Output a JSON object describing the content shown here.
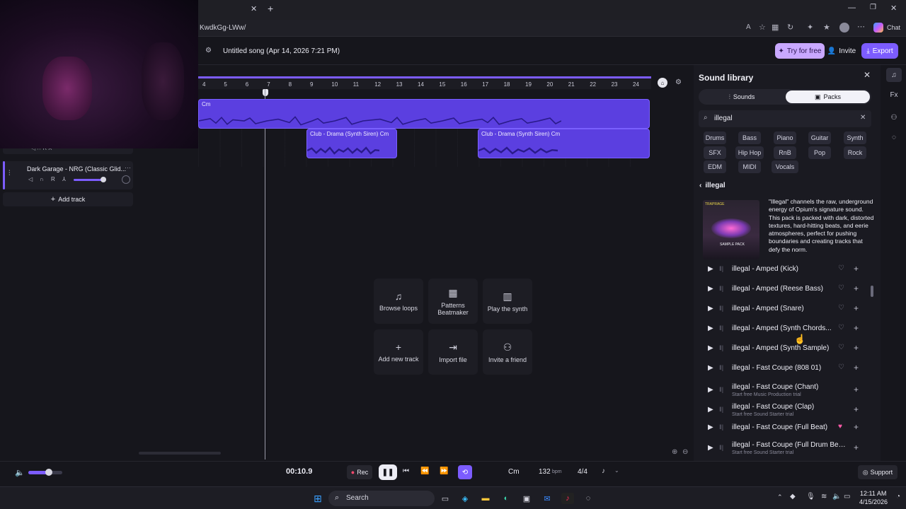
{
  "browser": {
    "address_text": "KwdkGg-LWw/",
    "chat_label": "Chat"
  },
  "header": {
    "song_title": "Untitled song (Apr 14, 2026 7:21 PM)",
    "try_free_label": "Try for free",
    "invite_label": "Invite",
    "export_label": "Export"
  },
  "timeline": {
    "ruler_ticks": [
      "4",
      "5",
      "6",
      "7",
      "8",
      "9",
      "10",
      "11",
      "12",
      "13",
      "14",
      "15",
      "16",
      "17",
      "18",
      "19",
      "20",
      "21",
      "22",
      "23",
      "24"
    ],
    "top_clip_label": "Cm",
    "clips": [
      {
        "label": "Club - Drama (Synth Siren) Cm"
      },
      {
        "label": "Club - Drama (Synth Siren) Cm"
      }
    ]
  },
  "tracks": {
    "items": [
      {
        "name": "Dark Garage - NRG (Classic Glid..."
      }
    ],
    "add_track_label": "Add track"
  },
  "actions": [
    {
      "label": "Browse loops",
      "icon": "music-note-icon"
    },
    {
      "label": "Patterns Beatmaker",
      "icon": "grid-icon"
    },
    {
      "label": "Play the synth",
      "icon": "piano-icon"
    },
    {
      "label": "Add new track",
      "icon": "plus-icon"
    },
    {
      "label": "Import file",
      "icon": "import-icon"
    },
    {
      "label": "Invite a friend",
      "icon": "add-person-icon"
    }
  ],
  "library": {
    "title": "Sound library",
    "tabs": [
      {
        "label": "Sounds",
        "active": false
      },
      {
        "label": "Packs",
        "active": true
      }
    ],
    "search_value": "illegal",
    "chips": [
      "Drums",
      "Bass",
      "Piano",
      "Guitar",
      "Synth",
      "SFX",
      "Hip Hop",
      "RnB",
      "Pop",
      "Rock",
      "EDM",
      "MIDI",
      "Vocals"
    ],
    "back_label": "illegal",
    "pack_description": "\"Illegal\" channels the raw, underground energy of Opium's signature sound. This pack is packed with dark, distorted textures, hard-hitting beats, and eerie atmospheres, perfect for pushing boundaries and creating tracks that defy the norm.",
    "pack_cover_text": [
      "TRAPRAGE",
      "SAMPLE PACK"
    ],
    "sounds": [
      {
        "name": "illegal - Amped (Kick)",
        "sub": "",
        "liked": false
      },
      {
        "name": "illegal - Amped (Reese Bass)",
        "sub": "",
        "liked": false
      },
      {
        "name": "illegal - Amped (Snare)",
        "sub": "",
        "liked": false
      },
      {
        "name": "illegal - Amped (Synth Chords...",
        "sub": "",
        "liked": false
      },
      {
        "name": "illegal - Amped (Synth Sample)",
        "sub": "",
        "liked": false
      },
      {
        "name": "illegal - Fast Coupe (808 01)",
        "sub": "",
        "liked": false
      },
      {
        "name": "illegal - Fast Coupe (Chant)",
        "sub": "Start free Music Production trial",
        "liked": false
      },
      {
        "name": "illegal - Fast Coupe (Clap)",
        "sub": "Start free Sound Starter trial",
        "liked": false
      },
      {
        "name": "illegal - Fast Coupe (Full Beat)",
        "sub": "",
        "liked": true
      },
      {
        "name": "illegal - Fast Coupe (Full Drum Bea...",
        "sub": "Start free Sound Starter trial",
        "liked": false
      }
    ]
  },
  "transport": {
    "time": "00:10.9",
    "rec_label": "Rec",
    "key": "Cm",
    "bpm_value": "132",
    "bpm_unit": "bpm",
    "time_signature": "4/4",
    "volume_level": 0.6,
    "support_label": "Support"
  },
  "taskbar": {
    "search_label": "Search",
    "clock_time": "12:11 AM",
    "clock_date": "4/15/2026"
  },
  "colors": {
    "accent": "#7c5cff",
    "clip": "#5b3fe0",
    "rec": "#ff4a6e",
    "heart": "#ff5aa8"
  }
}
